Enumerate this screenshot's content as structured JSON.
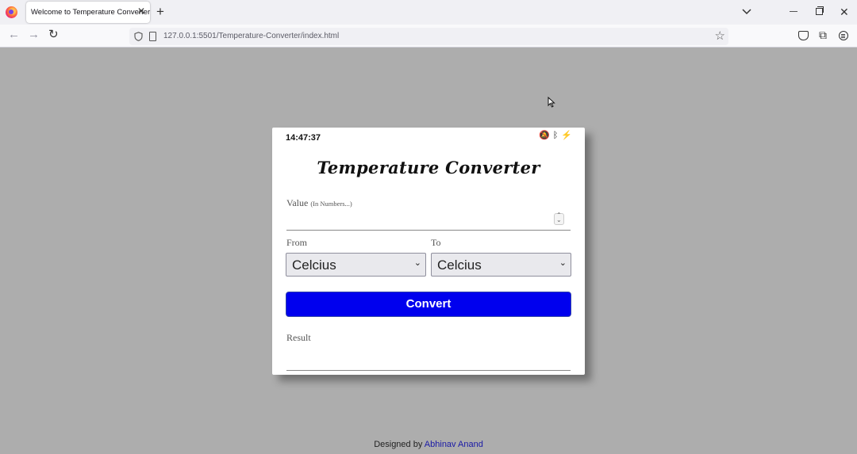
{
  "browser": {
    "tab_title": "Welcome to Temperature Converter",
    "url": "127.0.0.1:5501/Temperature-Converter/index.html"
  },
  "card": {
    "clock": "14:47:37",
    "title": "Temperature Converter",
    "value_label": "Value",
    "value_hint": "(In Numbers...)",
    "value_input": "",
    "from_label": "From",
    "to_label": "To",
    "from_selected": "Celcius",
    "to_selected": "Celcius",
    "convert_label": "Convert",
    "result_label": "Result",
    "result_value": ""
  },
  "footer": {
    "prefix": "Designed by",
    "author": "Abhinav Anand"
  },
  "colors": {
    "page_background": "#adadad",
    "convert_button": "#0000ee",
    "author_link": "#1a1aa6"
  },
  "icons": [
    "firefox-logo-icon",
    "tab-close-icon",
    "new-tab-icon",
    "list-all-tabs-icon",
    "minimize-icon",
    "restore-icon",
    "window-close-icon",
    "back-icon",
    "forward-icon",
    "reload-icon",
    "shield-icon",
    "page-icon",
    "bookmark-star-icon",
    "pocket-icon",
    "extensions-icon",
    "menu-icon",
    "muted-bell-icon",
    "bluetooth-icon",
    "battery-icon"
  ]
}
